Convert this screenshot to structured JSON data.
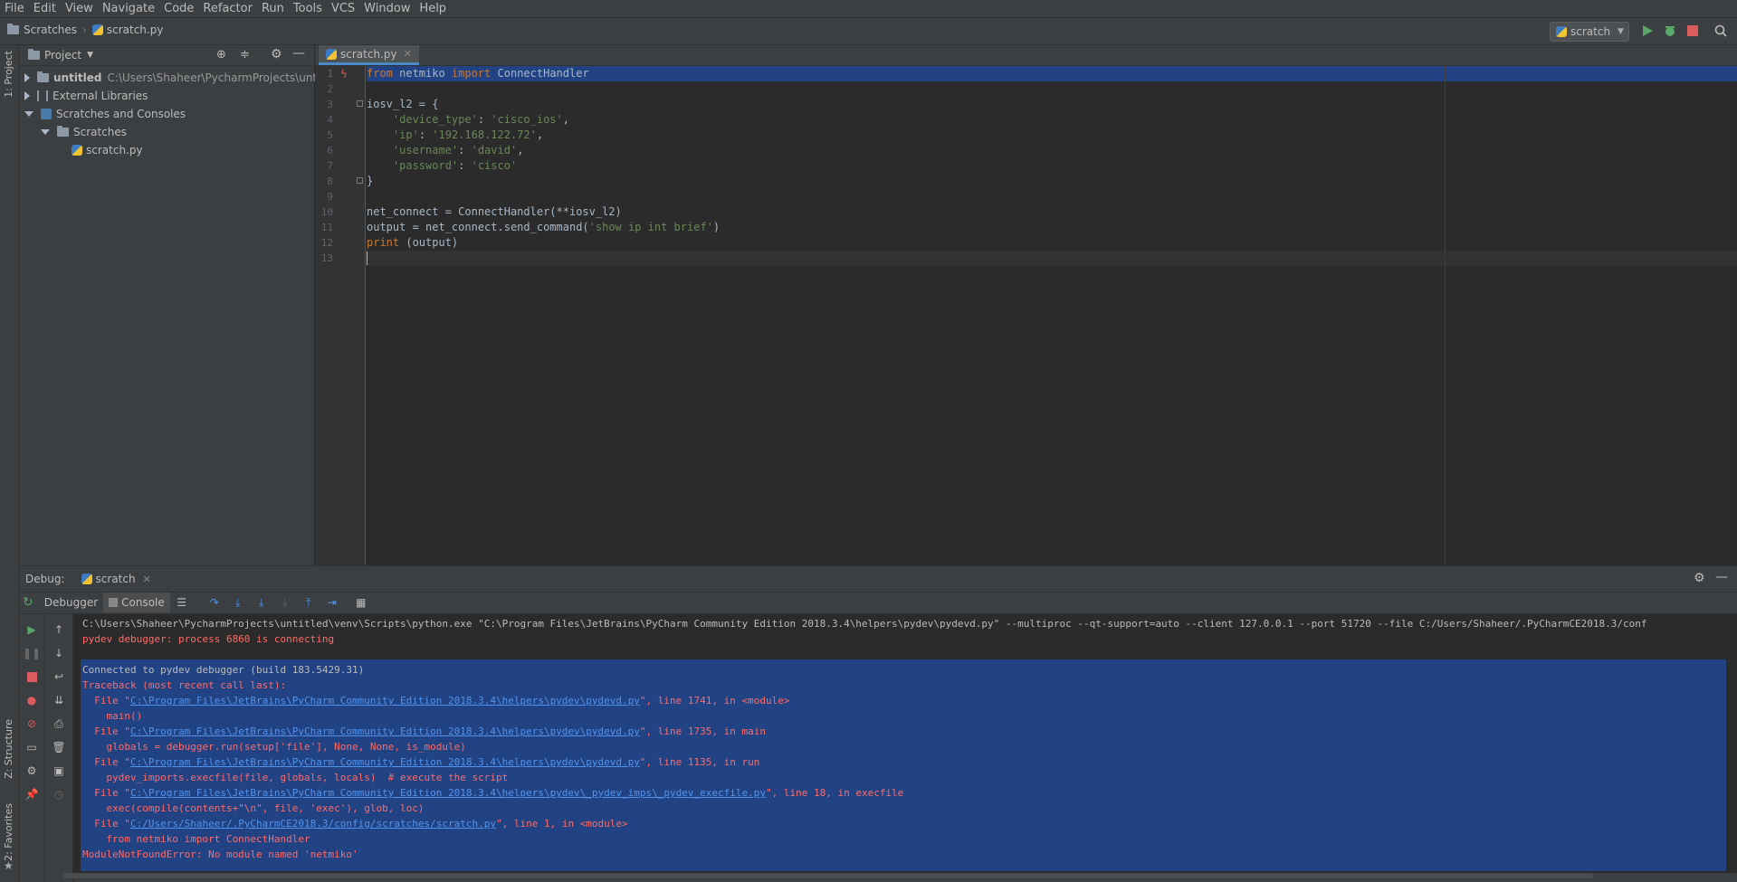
{
  "menu": [
    "File",
    "Edit",
    "View",
    "Navigate",
    "Code",
    "Refactor",
    "Run",
    "Tools",
    "VCS",
    "Window",
    "Help"
  ],
  "navbar": {
    "breadcrumbs": [
      "Scratches",
      "scratch.py"
    ],
    "run_config": "scratch"
  },
  "left_stripe": {
    "project_tab": "1: Project",
    "structure_tab": "Z: Structure",
    "favorites_tab": "2: Favorites"
  },
  "project_panel": {
    "title": "Project",
    "tree": [
      {
        "name": "untitled",
        "path": "C:\\Users\\Shaheer\\PycharmProjects\\untitled"
      },
      {
        "name": "External Libraries"
      },
      {
        "name": "Scratches and Consoles"
      },
      {
        "name": "Scratches"
      },
      {
        "name": "scratch.py"
      }
    ]
  },
  "editor": {
    "tab": "scratch.py",
    "line_numbers": [
      "1",
      "2",
      "3",
      "4",
      "5",
      "6",
      "7",
      "8",
      "9",
      "10",
      "11",
      "12",
      "13"
    ],
    "code": {
      "l1_kw1": "from",
      "l1_mod": " netmiko ",
      "l1_kw2": "import",
      "l1_name": " ConnectHandler",
      "l3": "iosv_l2 = {",
      "l4_key": "'device_type'",
      "l4_colon": ": ",
      "l4_val": "'cisco_ios'",
      "l4_comma": ",",
      "l5_key": "'ip'",
      "l5_colon": ": ",
      "l5_val": "'192.168.122.72'",
      "l5_comma": ",",
      "l6_key": "'username'",
      "l6_colon": ": ",
      "l6_val": "'david'",
      "l6_comma": ",",
      "l7_key": "'password'",
      "l7_colon": ": ",
      "l7_val": "'cisco'",
      "l8": "}",
      "l10": "net_connect = ConnectHandler(**iosv_l2)",
      "l11_a": "output = net_connect.send_command(",
      "l11_str": "'show ip int brief'",
      "l11_b": ")",
      "l12_kw": "print",
      "l12_rest": " (output)"
    }
  },
  "debug": {
    "label": "Debug:",
    "session": "scratch",
    "tabs": [
      "Debugger",
      "Console"
    ],
    "console": [
      {
        "t": "out",
        "text": "C:\\Users\\Shaheer\\PycharmProjects\\untitled\\venv\\Scripts\\python.exe \"C:\\Program Files\\JetBrains\\PyCharm Community Edition 2018.3.4\\helpers\\pydev\\pydevd.py\" --multiproc --qt-support=auto --client 127.0.0.1 --port 51720 --file C:/Users/Shaheer/.PyCharmCE2018.3/conf"
      },
      {
        "t": "err",
        "text": "pydev debugger: process 6860 is connecting"
      },
      {
        "t": "blank",
        "text": ""
      },
      {
        "t": "out",
        "text": "Connected to pydev debugger (build 183.5429.31)"
      },
      {
        "t": "err",
        "text": "Traceback (most recent call last):"
      },
      {
        "t": "file",
        "pre": "  File \"",
        "link": "C:\\Program Files\\JetBrains\\PyCharm Community Edition 2018.3.4\\helpers\\pydev\\pydevd.py",
        "post": "\", line 1741, in <module>"
      },
      {
        "t": "err",
        "text": "    main()"
      },
      {
        "t": "file",
        "pre": "  File \"",
        "link": "C:\\Program Files\\JetBrains\\PyCharm Community Edition 2018.3.4\\helpers\\pydev\\pydevd.py",
        "post": "\", line 1735, in main"
      },
      {
        "t": "err",
        "text": "    globals = debugger.run(setup['file'], None, None, is_module)"
      },
      {
        "t": "file",
        "pre": "  File \"",
        "link": "C:\\Program Files\\JetBrains\\PyCharm Community Edition 2018.3.4\\helpers\\pydev\\pydevd.py",
        "post": "\", line 1135, in run"
      },
      {
        "t": "err",
        "text": "    pydev_imports.execfile(file, globals, locals)  # execute the script"
      },
      {
        "t": "file",
        "pre": "  File \"",
        "link": "C:\\Program Files\\JetBrains\\PyCharm Community Edition 2018.3.4\\helpers\\pydev\\_pydev_imps\\_pydev_execfile.py",
        "post": "\", line 18, in execfile"
      },
      {
        "t": "err",
        "text": "    exec(compile(contents+\"\\n\", file, 'exec'), glob, loc)"
      },
      {
        "t": "file",
        "pre": "  File \"",
        "link": "C:/Users/Shaheer/.PyCharmCE2018.3/config/scratches/scratch.py",
        "post": "\", line 1, in <module>"
      },
      {
        "t": "err",
        "text": "    from netmiko import ConnectHandler"
      },
      {
        "t": "err",
        "text": "ModuleNotFoundError: No module named 'netmiko'"
      }
    ]
  },
  "colors": {
    "accent": "#4a88c7",
    "selection": "#214283",
    "error": "#ff6b68",
    "link": "#5394ec",
    "run": "#59a869",
    "stop": "#db5c5c"
  }
}
